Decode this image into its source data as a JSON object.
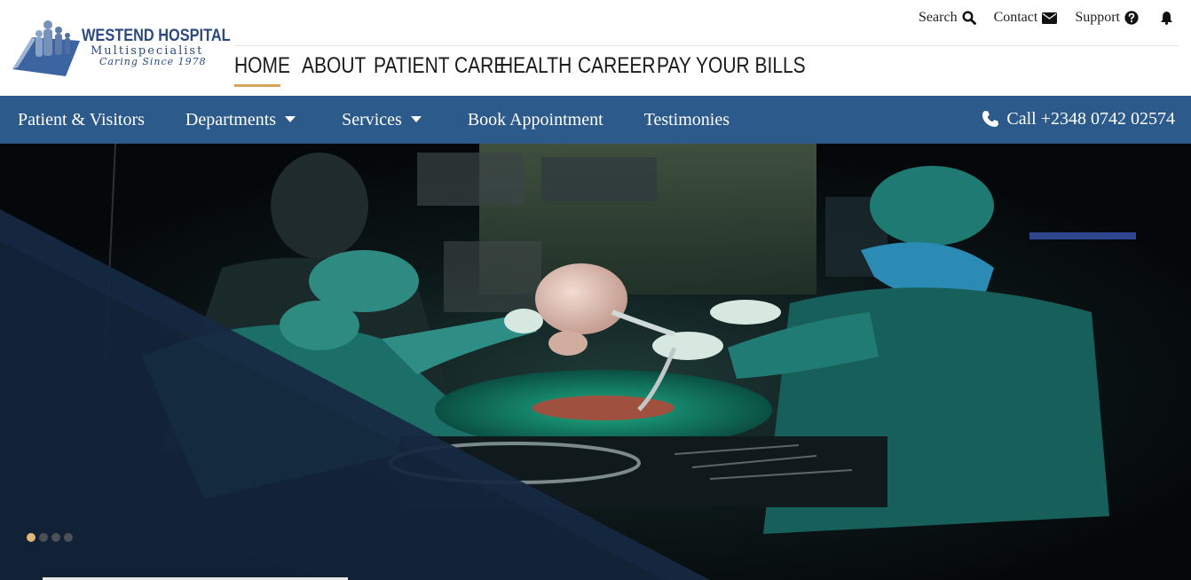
{
  "logo": {
    "name": "WESTEND HOSPITAL",
    "subtitle": "Multispecialist",
    "tagline": "Caring Since 1978"
  },
  "utility_nav": {
    "search": "Search",
    "contact": "Contact",
    "support": "Support",
    "icons": [
      "search-icon",
      "envelope-icon",
      "question-circle-icon",
      "bell-icon"
    ]
  },
  "main_nav": {
    "items": [
      {
        "label": "HOME",
        "active": true
      },
      {
        "label": "ABOUT",
        "active": false
      },
      {
        "label": "PATIENT CARE",
        "active": false
      },
      {
        "label": "HEALTH",
        "active": false
      },
      {
        "label": "CAREER",
        "active": false
      },
      {
        "label": "PAY YOUR BILLS",
        "active": false
      }
    ]
  },
  "secondary_nav": {
    "items": [
      {
        "label": "Patient & Visitors",
        "has_dropdown": false
      },
      {
        "label": "Departments",
        "has_dropdown": true
      },
      {
        "label": "Services",
        "has_dropdown": true
      },
      {
        "label": "Book Appointment",
        "has_dropdown": false
      },
      {
        "label": "Testimonies",
        "has_dropdown": false
      }
    ],
    "call_label": "Call +2348 0742 02574"
  },
  "hero": {
    "slide_count": 4,
    "active_slide": 1
  },
  "colors": {
    "brand_blue": "#2c5a8a",
    "logo_blue": "#2a4a7f",
    "accent_gold": "#d6a25c",
    "active_dot": "#e2b77a",
    "scrub_green": "#1a6b66"
  }
}
